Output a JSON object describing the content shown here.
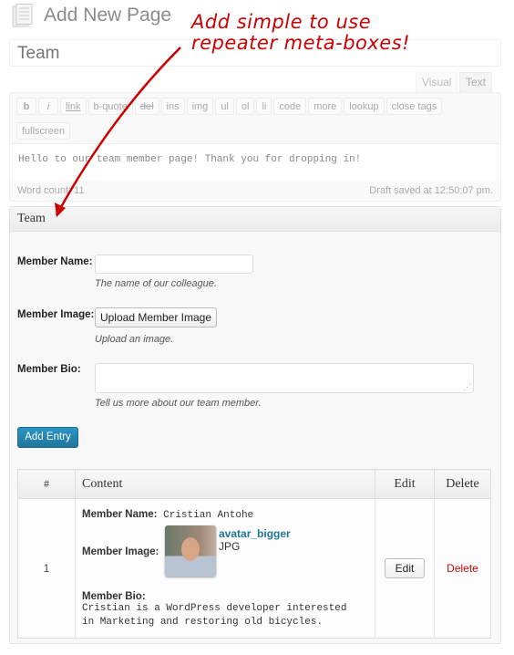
{
  "header": {
    "title": "Add New Page",
    "page_title_value": "Team"
  },
  "editor": {
    "tabs": [
      "Visual",
      "Text"
    ],
    "active_tab": "Text",
    "toolbar": [
      "b",
      "i",
      "link",
      "b-quote",
      "del",
      "ins",
      "img",
      "ul",
      "ol",
      "li",
      "code",
      "more",
      "lookup",
      "close tags",
      "fullscreen"
    ],
    "content": "Hello to our team member page! Thank you for dropping in!",
    "word_count": "Word count: 11",
    "draft_status": "Draft saved at 12:50:07 pm."
  },
  "metabox": {
    "title": "Team",
    "fields": {
      "name_label": "Member Name:",
      "name_desc": "The name of our colleague.",
      "image_label": "Member Image:",
      "image_button": "Upload Member Image",
      "image_desc": "Upload an image.",
      "bio_label": "Member Bio:",
      "bio_desc": "Tell us more about our team member."
    },
    "add_entry": "Add Entry",
    "table": {
      "headers": [
        "#",
        "Content",
        "Edit",
        "Delete"
      ],
      "rows": [
        {
          "num": "1",
          "name_label": "Member Name:",
          "name": "Cristian Antohe",
          "image_label": "Member Image:",
          "image_name": "avatar_bigger",
          "image_type": "JPG",
          "bio_label": "Member Bio:",
          "bio": "Cristian is a WordPress developer interested in Marketing and restoring old bicycles.",
          "edit": "Edit",
          "delete": "Delete"
        }
      ]
    }
  },
  "annotation": {
    "line1": "Add simple to use",
    "line2": "repeater meta-boxes!"
  },
  "colors": {
    "annotation": "#cc0000",
    "primary_button": "#21759b",
    "delete_link": "#bc0b0b",
    "link": "#21759b"
  }
}
